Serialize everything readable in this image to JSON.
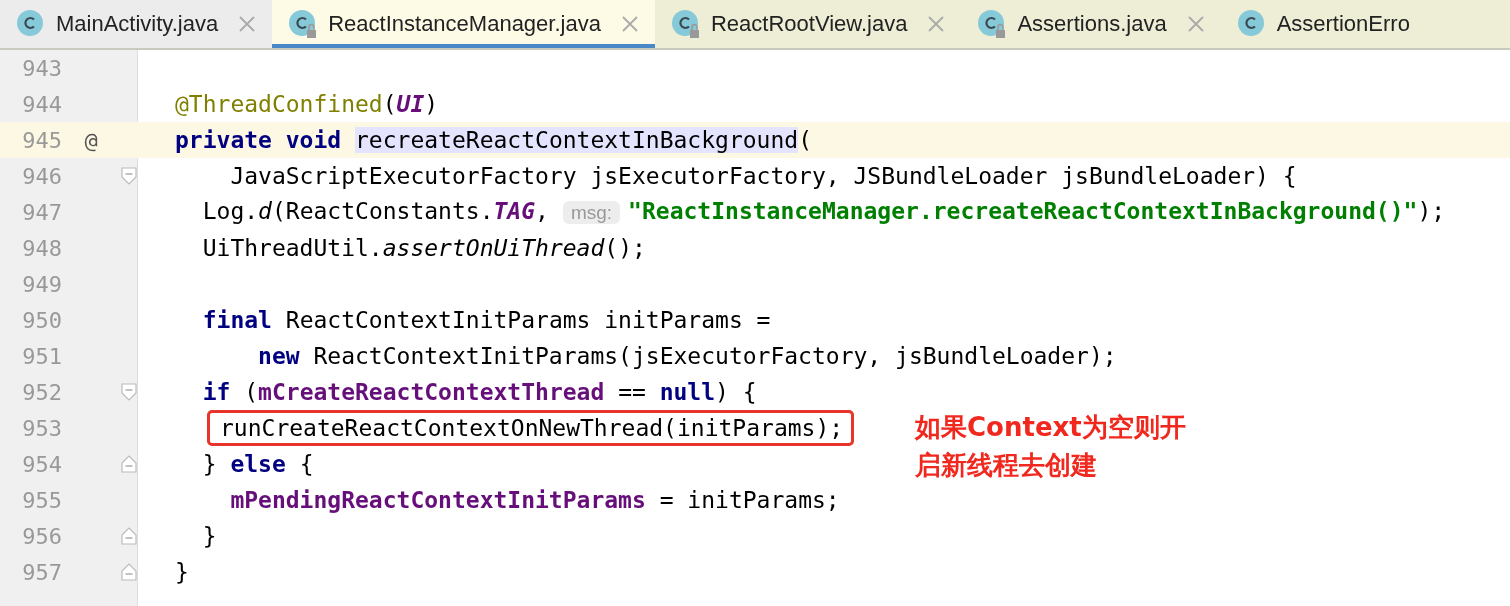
{
  "tabs": [
    {
      "label": "MainActivity.java",
      "selected": false,
      "locked": false,
      "closable": true,
      "color": "#ececec"
    },
    {
      "label": "ReactInstanceManager.java",
      "selected": true,
      "locked": true,
      "closable": true,
      "color": "#fdfbe6"
    },
    {
      "label": "ReactRootView.java",
      "selected": false,
      "locked": true,
      "closable": true,
      "color": "#eeedd5"
    },
    {
      "label": "Assertions.java",
      "selected": false,
      "locked": true,
      "closable": true,
      "color": "#eeedd5"
    },
    {
      "label": "AssertionErro",
      "selected": false,
      "locked": false,
      "closable": false,
      "color": "#eeedd5"
    }
  ],
  "lines": [
    {
      "number": "943"
    },
    {
      "number": "944",
      "tokens": [
        {
          "text": "@ThreadConfined",
          "kind": "annotation"
        },
        {
          "text": "(",
          "kind": "plain"
        },
        {
          "text": "UI",
          "kind": "static"
        },
        {
          "text": ")",
          "kind": "plain"
        }
      ]
    },
    {
      "number": "945",
      "current": true,
      "marker": "@",
      "tokens": [
        {
          "text": "private void ",
          "kind": "keyword"
        },
        {
          "text": "recreateReactContextInBackground",
          "kind": "usage"
        },
        {
          "text": "(",
          "kind": "plain"
        }
      ]
    },
    {
      "number": "946",
      "fold": {
        "kind": "start"
      },
      "tokens": [
        {
          "text": "    JavaScriptExecutorFactory jsExecutorFactory, JSBundleLoader jsBundleLoader) {",
          "kind": "plain"
        }
      ]
    },
    {
      "number": "947",
      "tokens": [
        {
          "text": "  Log.",
          "kind": "plain"
        },
        {
          "text": "d",
          "kind": "method"
        },
        {
          "text": "(ReactConstants.",
          "kind": "plain"
        },
        {
          "text": "TAG",
          "kind": "static"
        },
        {
          "text": ",",
          "kind": "plain"
        },
        {
          "text": "msg:",
          "kind": "hint"
        },
        {
          "text": "\"ReactInstanceManager.recreateReactContextInBackground()\"",
          "kind": "string"
        },
        {
          "text": ");",
          "kind": "plain"
        }
      ]
    },
    {
      "number": "948",
      "tokens": [
        {
          "text": "  UiThreadUtil.",
          "kind": "plain"
        },
        {
          "text": "assertOnUiThread",
          "kind": "method"
        },
        {
          "text": "();",
          "kind": "plain"
        }
      ]
    },
    {
      "number": "949"
    },
    {
      "number": "950",
      "tokens": [
        {
          "text": "  final",
          "kind": "keyword"
        },
        {
          "text": " ReactContextInitParams initParams =",
          "kind": "plain"
        }
      ]
    },
    {
      "number": "951",
      "tokens": [
        {
          "text": "      new",
          "kind": "keyword"
        },
        {
          "text": " ReactContextInitParams(jsExecutorFactory, jsBundleLoader);",
          "kind": "plain"
        }
      ]
    },
    {
      "number": "952",
      "fold": {
        "kind": "start"
      },
      "tokens": [
        {
          "text": "  if",
          "kind": "keyword"
        },
        {
          "text": " (",
          "kind": "plain"
        },
        {
          "text": "mCreateReactContextThread",
          "kind": "field"
        },
        {
          "text": " == ",
          "kind": "plain"
        },
        {
          "text": "null",
          "kind": "keyword"
        },
        {
          "text": ") {",
          "kind": "plain"
        }
      ]
    },
    {
      "number": "953",
      "boxed": true,
      "tokens": [
        {
          "text": "runCreateReactContextOnNewThread(initParams);",
          "kind": "plain"
        }
      ]
    },
    {
      "number": "954",
      "fold": {
        "kind": "end"
      },
      "tokens": [
        {
          "text": "  } ",
          "kind": "plain"
        },
        {
          "text": "else",
          "kind": "keyword"
        },
        {
          "text": " {",
          "kind": "plain"
        }
      ]
    },
    {
      "number": "955",
      "tokens": [
        {
          "text": "    mPendingReactContextInitParams",
          "kind": "field"
        },
        {
          "text": " = initParams;",
          "kind": "plain"
        }
      ]
    },
    {
      "number": "956",
      "fold": {
        "kind": "end"
      },
      "tokens": [
        {
          "text": "  }",
          "kind": "plain"
        }
      ]
    },
    {
      "number": "957",
      "fold": {
        "kind": "end"
      },
      "tokens": [
        {
          "text": "}",
          "kind": "plain"
        }
      ]
    }
  ],
  "annotation": {
    "lines": [
      "如果Context为空则开",
      "启新线程去创建"
    ]
  }
}
